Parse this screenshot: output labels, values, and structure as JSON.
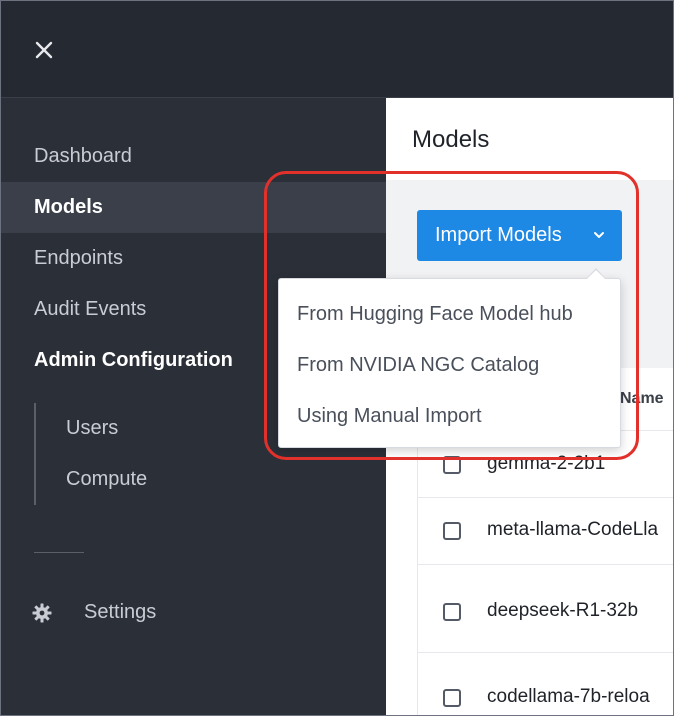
{
  "header": {
    "close_icon": "close-icon"
  },
  "sidebar": {
    "items": [
      {
        "label": "Dashboard"
      },
      {
        "label": "Models"
      },
      {
        "label": "Endpoints"
      },
      {
        "label": "Audit Events"
      }
    ],
    "section_label": "Admin Configuration",
    "sub_items": [
      {
        "label": "Users"
      },
      {
        "label": "Compute"
      }
    ],
    "settings_label": "Settings"
  },
  "main": {
    "title": "Models",
    "import_button_label": "Import Models",
    "table": {
      "header_name": "Name",
      "rows": [
        {
          "name": "gemma-2-2b1"
        },
        {
          "name": "meta-llama-CodeLla"
        },
        {
          "name": "deepseek-R1-32b"
        },
        {
          "name": "codellama-7b-reloa"
        }
      ]
    }
  },
  "dropdown": {
    "items": [
      {
        "label": "From Hugging Face Model hub"
      },
      {
        "label": "From NVIDIA NGC Catalog"
      },
      {
        "label": "Using Manual Import"
      }
    ]
  },
  "colors": {
    "accent": "#1e88e5",
    "highlight": "#e2312b",
    "sidebar_bg": "#2b2f38"
  }
}
